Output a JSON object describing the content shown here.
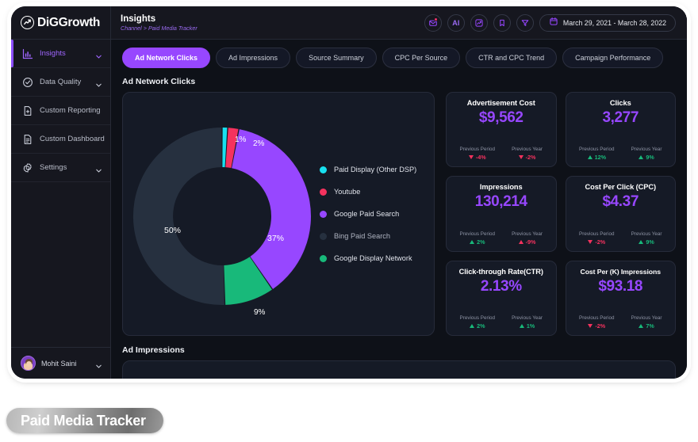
{
  "brand": {
    "name": "DiGGrowth",
    "logo_icon": "trend-circle-icon"
  },
  "sidebar": {
    "items": [
      {
        "label": "Insights",
        "icon": "bar-chart-icon",
        "active": true,
        "has_chevron": true
      },
      {
        "label": "Data Quality",
        "icon": "check-circle-icon",
        "active": false,
        "has_chevron": true
      },
      {
        "label": "Custom Reporting",
        "icon": "file-plus-icon",
        "active": false,
        "has_chevron": false
      },
      {
        "label": "Custom Dashboard",
        "icon": "file-lines-icon",
        "active": false,
        "has_chevron": false
      },
      {
        "label": "Settings",
        "icon": "gear-icon",
        "active": false,
        "has_chevron": true
      }
    ],
    "user": {
      "name": "Mohit Saini"
    }
  },
  "header": {
    "title": "Insights",
    "breadcrumb": "Channel > Paid Media Tracker",
    "actions": [
      {
        "icon": "mail-icon",
        "badge": true
      },
      {
        "icon": "ai-icon",
        "text": "AI"
      },
      {
        "icon": "line-chart-icon",
        "badge": false
      },
      {
        "icon": "bookmark-icon",
        "badge": false
      },
      {
        "icon": "filter-icon",
        "badge": false
      }
    ],
    "date_range": {
      "icon": "calendar-icon",
      "value": "March 29, 2021 - March 28, 2022"
    }
  },
  "tabs": [
    {
      "label": "Ad Network Clicks",
      "active": true
    },
    {
      "label": "Ad Impressions",
      "active": false
    },
    {
      "label": "Source Summary",
      "active": false
    },
    {
      "label": "CPC Per Source",
      "active": false
    },
    {
      "label": "CTR and CPC Trend",
      "active": false
    },
    {
      "label": "Campaign Performance",
      "active": false
    }
  ],
  "sections": {
    "primary_title": "Ad Network Clicks",
    "secondary_title": "Ad Impressions"
  },
  "chart_data": {
    "type": "pie",
    "title": "Ad Network Clicks",
    "donut": true,
    "legend_position": "right",
    "categories": [
      "Paid Display (Other DSP)",
      "Youtube",
      "Google Paid Search",
      "Bing Paid Search",
      "Google Display Network"
    ],
    "values": [
      1,
      2,
      37,
      50,
      9
    ],
    "labels": [
      "1%",
      "2%",
      "37%",
      "50%",
      "9%"
    ],
    "colors": [
      "#18e0ef",
      "#f5325e",
      "#9747ff",
      "#26303f",
      "#18b97a"
    ],
    "slice_order": [
      "Paid Display (Other DSP)",
      "Youtube",
      "Google Paid Search",
      "Google Display Network",
      "Bing Paid Search"
    ]
  },
  "kpis": [
    {
      "title": "Advertisement Cost",
      "value": "$9,562",
      "previous_period": {
        "label": "Previous Period",
        "value": "-4%",
        "direction": "down",
        "color": "#f5325e"
      },
      "previous_year": {
        "label": "Previous Year",
        "value": "-2%",
        "direction": "down",
        "color": "#f5325e"
      }
    },
    {
      "title": "Clicks",
      "value": "3,277",
      "previous_period": {
        "label": "Previous Period",
        "value": "12%",
        "direction": "up",
        "color": "#18b97a"
      },
      "previous_year": {
        "label": "Previous Year",
        "value": "9%",
        "direction": "up",
        "color": "#18b97a"
      }
    },
    {
      "title": "Impressions",
      "value": "130,214",
      "previous_period": {
        "label": "Previous Period",
        "value": "2%",
        "direction": "up",
        "color": "#18b97a"
      },
      "previous_year": {
        "label": "Previous Year",
        "value": "-9%",
        "direction": "up",
        "color": "#f5325e"
      }
    },
    {
      "title": "Cost Per Click (CPC)",
      "value": "$4.37",
      "previous_period": {
        "label": "Previous Period",
        "value": "-2%",
        "direction": "down",
        "color": "#f5325e"
      },
      "previous_year": {
        "label": "Previous Year",
        "value": "9%",
        "direction": "up",
        "color": "#18b97a"
      }
    },
    {
      "title": "Click-through Rate(CTR)",
      "value": "2.13%",
      "previous_period": {
        "label": "Previous Period",
        "value": "2%",
        "direction": "up",
        "color": "#18b97a"
      },
      "previous_year": {
        "label": "Previous Year",
        "value": "1%",
        "direction": "up",
        "color": "#18b97a"
      }
    },
    {
      "title": "Cost Per (K) Impressions",
      "value": "$93.18",
      "previous_period": {
        "label": "Previous Period",
        "value": "-2%",
        "direction": "down",
        "color": "#f5325e"
      },
      "previous_year": {
        "label": "Previous Year",
        "value": "7%",
        "direction": "up",
        "color": "#18b97a"
      }
    }
  ],
  "page_label": "Paid Media Tracker",
  "theme": {
    "accent": "#9747ff",
    "positive": "#18b97a",
    "negative": "#f5325e",
    "card_bg": "#151a26",
    "page_bg": "#0e1118"
  }
}
